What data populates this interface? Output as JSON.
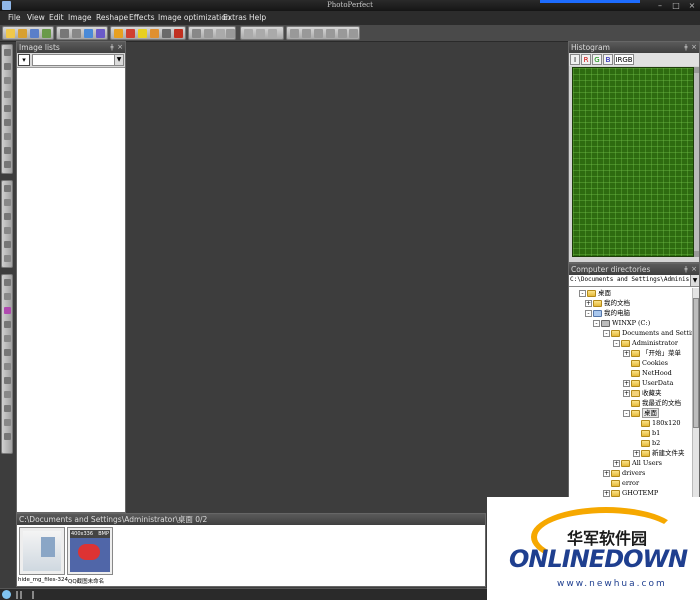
{
  "window": {
    "title": "PhotoPerfect"
  },
  "menu": [
    "File",
    "View",
    "Edit",
    "Image",
    "Reshape",
    "Effects",
    "Image optimization",
    "Extras",
    "Help"
  ],
  "panels": {
    "image_lists": {
      "title": "Image lists",
      "combo_value": ""
    },
    "histogram": {
      "title": "Histogram",
      "tabs": [
        "I",
        "R",
        "G",
        "B",
        "IRGB"
      ]
    },
    "directories": {
      "title": "Computer directories",
      "path": "C:\\Documents and Settings\\Administrator",
      "tree": [
        {
          "label": "桌面",
          "icon": "folder-icon",
          "expander": "-"
        },
        {
          "label": "我的文档",
          "icon": "folder-icon",
          "expander": "+"
        },
        {
          "label": "我的电脑",
          "icon": "computer-icon",
          "expander": "-"
        },
        {
          "label": "WINXP (C:)",
          "icon": "drive-icon",
          "expander": "-"
        },
        {
          "label": "Documents and Settings",
          "icon": "folder-icon",
          "expander": "-"
        },
        {
          "label": "Administrator",
          "icon": "folder-icon",
          "expander": "-"
        },
        {
          "label": "「开始」菜单",
          "icon": "folder-icon",
          "expander": "+"
        },
        {
          "label": "Cookies",
          "icon": "folder-icon",
          "expander": ""
        },
        {
          "label": "NetHood",
          "icon": "folder-icon",
          "expander": ""
        },
        {
          "label": "UserData",
          "icon": "folder-icon",
          "expander": "+"
        },
        {
          "label": "收藏夹",
          "icon": "favorites-icon",
          "expander": "+"
        },
        {
          "label": "我最近的文档",
          "icon": "folder-icon",
          "expander": ""
        },
        {
          "label": "桌面",
          "icon": "folder-icon",
          "expander": "-",
          "selected": true
        },
        {
          "label": "180x120",
          "icon": "folder-icon",
          "expander": ""
        },
        {
          "label": "b1",
          "icon": "folder-icon",
          "expander": ""
        },
        {
          "label": "b2",
          "icon": "folder-icon",
          "expander": ""
        },
        {
          "label": "新建文件夹",
          "icon": "folder-icon",
          "expander": "+"
        },
        {
          "label": "All Users",
          "icon": "folder-icon",
          "expander": "+"
        },
        {
          "label": "drivers",
          "icon": "folder-icon",
          "expander": "+"
        },
        {
          "label": "error",
          "icon": "folder-icon",
          "expander": ""
        },
        {
          "label": "GHOTEMP",
          "icon": "folder-icon",
          "expander": "+"
        }
      ]
    },
    "thumbnails": {
      "title": "C:\\Documents and Settings\\Administrator\\桌面 0/2",
      "items": [
        {
          "label": "hide_mg_files-324..."
        },
        {
          "label": "QQ截图未命名",
          "size": "400x336",
          "format": "BMP"
        }
      ]
    }
  },
  "watermark": {
    "cn": "华军软件园",
    "en": "ONLINEDOWN",
    "url": "www.newhua.com"
  }
}
